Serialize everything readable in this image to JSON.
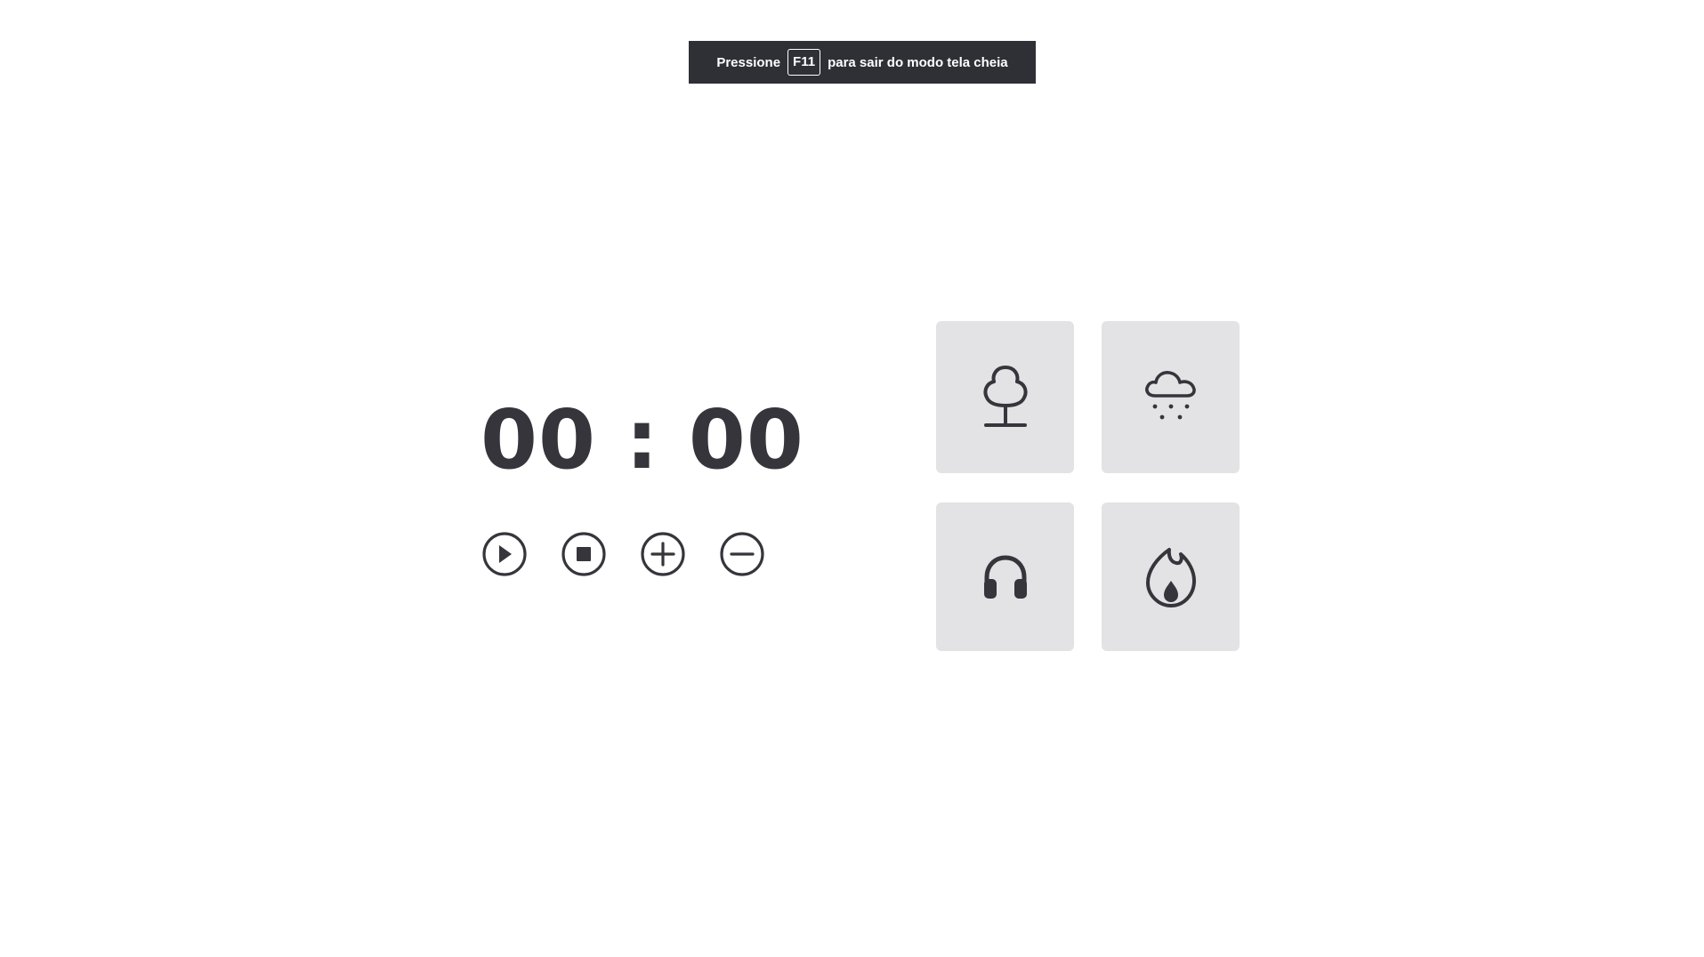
{
  "fullscreen_notice": {
    "prefix": "Pressione",
    "key": "F11",
    "suffix": "para sair do modo tela cheia"
  },
  "timer": {
    "display": "00 : 00"
  },
  "controls": [
    {
      "name": "play-button",
      "icon": "play-icon"
    },
    {
      "name": "stop-button",
      "icon": "stop-icon"
    },
    {
      "name": "increase-button",
      "icon": "plus-icon"
    },
    {
      "name": "decrease-button",
      "icon": "minus-icon"
    }
  ],
  "sound_cards": [
    {
      "name": "forest-sound-card",
      "icon": "tree-icon"
    },
    {
      "name": "rain-sound-card",
      "icon": "cloud-rain-icon"
    },
    {
      "name": "coffee-shop-sound-card",
      "icon": "headphones-icon"
    },
    {
      "name": "fireplace-sound-card",
      "icon": "flame-icon"
    }
  ],
  "colors": {
    "text": "#35353b",
    "banner_bg": "#2f3035",
    "card_bg": "#e3e3e6",
    "page_bg": "#ffffff"
  }
}
